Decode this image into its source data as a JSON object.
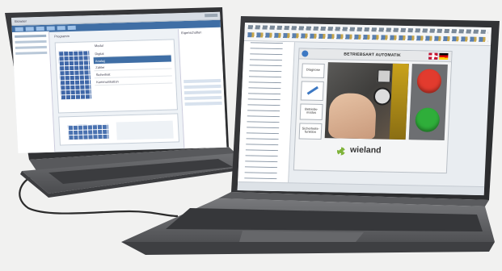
{
  "left_laptop": {
    "window_title": "Browser",
    "section_title": "Programm",
    "right_panel_title": "Eigenschaften",
    "module_title": "Modul",
    "module_rows": [
      "Digital",
      "Analog",
      "Zähler",
      "Sicherheit",
      "Kommunikation"
    ]
  },
  "right_laptop": {
    "hmi": {
      "title": "BETRIEBSART AUTOMATIK",
      "buttons": [
        {
          "label": "Diagnose"
        },
        {
          "label": ""
        },
        {
          "label": "Betriebs-\nmodus"
        },
        {
          "label": "Sicherheits-\nfunktion"
        }
      ],
      "brand": "wieland",
      "brand_sub": "",
      "language_flags": [
        "uk-flag",
        "de-flag"
      ],
      "status_colors": {
        "stop": "#e23b2e",
        "start": "#2fae3a"
      }
    }
  }
}
